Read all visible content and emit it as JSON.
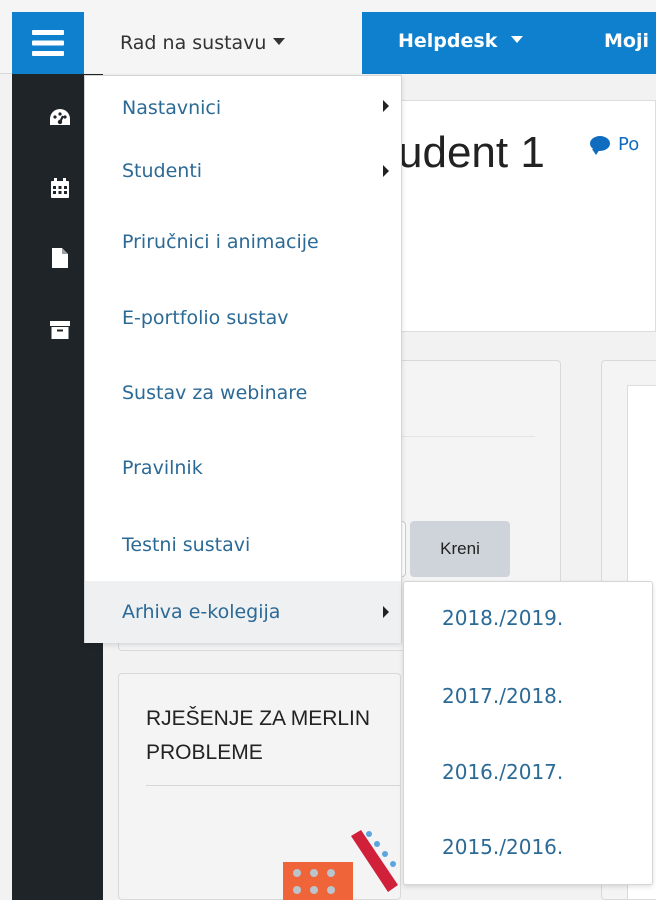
{
  "navbar": {
    "menu_label": "Rad na sustavu",
    "helpdesk_label": "Helpdesk",
    "moji_label": "Moji"
  },
  "sidebar": {
    "icons": [
      "dashboard-icon",
      "calendar-icon",
      "file-icon",
      "archive-icon"
    ]
  },
  "page": {
    "title": "udent 1",
    "post_label": "Po"
  },
  "content": {
    "go_button": "Kreni",
    "card_title_line1": "RJEŠENJE ZA MERLIN",
    "card_title_line2": "PROBLEME"
  },
  "dropdown": {
    "items": [
      {
        "label": "Nastavnici",
        "has_submenu": true
      },
      {
        "label": "Studenti",
        "has_submenu": true
      },
      {
        "label": "Priručnici i animacije",
        "has_submenu": false
      },
      {
        "label": "E-portfolio sustav",
        "has_submenu": false
      },
      {
        "label": "Sustav za webinare",
        "has_submenu": false
      },
      {
        "label": "Pravilnik",
        "has_submenu": false
      },
      {
        "label": "Testni sustavi",
        "has_submenu": false
      },
      {
        "label": "Arhiva e-kolegija",
        "has_submenu": true
      }
    ]
  },
  "submenu": {
    "items": [
      "2018./2019.",
      "2017./2018.",
      "2016./2017.",
      "2015./2016."
    ]
  },
  "colors": {
    "brand_blue": "#0f80cd",
    "sidebar_dark": "#1e2428",
    "link_blue": "#2c6a96"
  }
}
